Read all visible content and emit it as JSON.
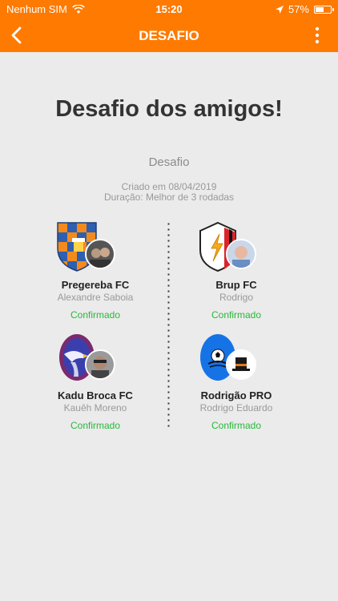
{
  "status_bar": {
    "carrier": "Nenhum SIM",
    "time": "15:20",
    "battery": "57%",
    "battery_level": 0.57
  },
  "nav": {
    "title": "DESAFIO"
  },
  "content": {
    "heading": "Desafio dos amigos!",
    "subtitle": "Desafio",
    "created": "Criado em 08/04/2019",
    "duration": "Duração: Melhor de 3 rodadas"
  },
  "teams": [
    {
      "name": "Pregereba FC",
      "owner": "Alexandre Saboia",
      "status": "Confirmado",
      "emblem": "blue-orange-checkered-shield-icon"
    },
    {
      "name": "Brup FC",
      "owner": "Rodrigo",
      "status": "Confirmado",
      "emblem": "lightning-shield-icon"
    },
    {
      "name": "Kadu Broca FC",
      "owner": "Kauêh Moreno",
      "status": "Confirmado",
      "emblem": "eagle-crest-icon"
    },
    {
      "name": "Rodrigão PRO",
      "owner": "Rodrigo Eduardo",
      "status": "Confirmado",
      "emblem": "soccer-ball-crest-icon"
    }
  ],
  "colors": {
    "primary": "#ff7a00",
    "confirmed": "#27b83a",
    "background": "#ebebeb"
  }
}
